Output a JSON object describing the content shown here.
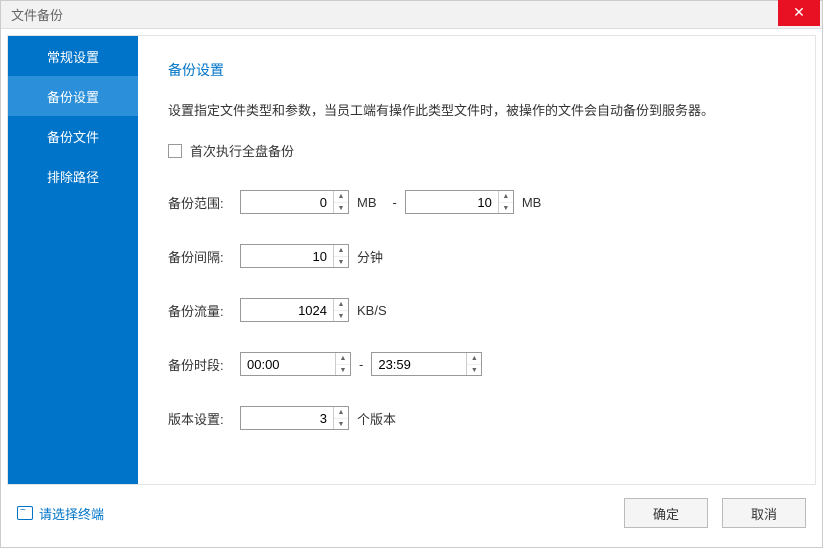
{
  "window": {
    "title": "文件备份"
  },
  "sidebar": {
    "items": [
      {
        "label": "常规设置"
      },
      {
        "label": "备份设置"
      },
      {
        "label": "备份文件"
      },
      {
        "label": "排除路径"
      }
    ]
  },
  "main": {
    "section_title": "备份设置",
    "description": "设置指定文件类型和参数，当员工端有操作此类型文件时，被操作的文件会自动备份到服务器。",
    "checkbox_label": "首次执行全盘备份",
    "rows": {
      "range": {
        "label": "备份范围:",
        "from": "0",
        "to": "10",
        "unit": "MB",
        "dash": "-"
      },
      "interval": {
        "label": "备份间隔:",
        "value": "10",
        "unit": "分钟"
      },
      "traffic": {
        "label": "备份流量:",
        "value": "1024",
        "unit": "KB/S"
      },
      "period": {
        "label": "备份时段:",
        "from": "00:00",
        "to": "23:59",
        "dash": "-"
      },
      "version": {
        "label": "版本设置:",
        "value": "3",
        "unit": "个版本"
      }
    }
  },
  "footer": {
    "terminal_link": "请选择终端",
    "ok": "确定",
    "cancel": "取消"
  }
}
